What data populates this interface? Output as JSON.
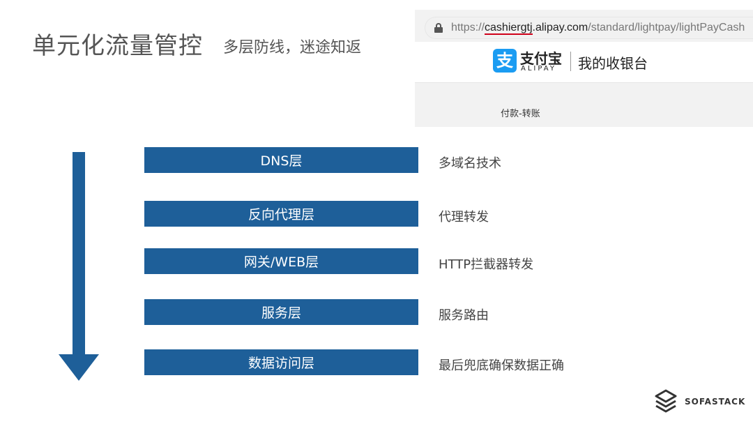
{
  "slide": {
    "title": "单元化流量管控",
    "subtitle": "多层防线，迷途知返"
  },
  "browser": {
    "url_prefix": "https://",
    "url_marked": "cashiergtj",
    "url_domain": ".alipay.com",
    "url_path": "/standard/lightpay/lightPayCash",
    "logo_glyph": "支",
    "brand_name": "支付宝",
    "brand_en": "ALIPAY",
    "cashier_title": "我的收银台",
    "tab_label": "付款-转账"
  },
  "layers": [
    {
      "label": "DNS层",
      "desc": "多域名技术"
    },
    {
      "label": "反向代理层",
      "desc": "代理转发"
    },
    {
      "label": "网关/WEB层",
      "desc": "HTTP拦截器转发"
    },
    {
      "label": "服务层",
      "desc": "服务路由"
    },
    {
      "label": "数据访问层",
      "desc": "最后兜底确保数据正确"
    }
  ],
  "footer": {
    "brand": "SOFASTACK"
  },
  "colors": {
    "layer_fill": "#1e5f99",
    "arrow_fill": "#1e5f99",
    "alipay_blue": "#1b9cf2",
    "url_mark": "#d0021b"
  }
}
